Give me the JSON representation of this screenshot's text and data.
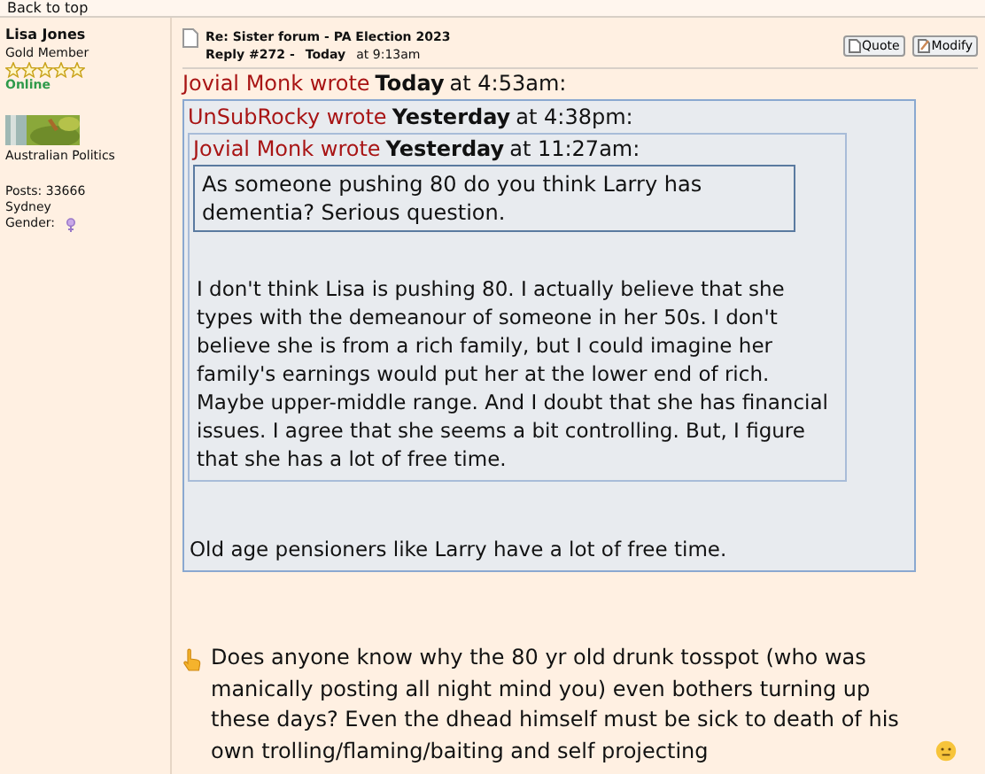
{
  "back_to_top": "Back to top",
  "author": {
    "name": "Lisa Jones",
    "rank": "Gold Member",
    "stars": 5,
    "status": "Online",
    "group": "Australian Politics",
    "posts": "Posts: 33666",
    "location": "Sydney",
    "gender_label": "Gender:"
  },
  "post": {
    "title": "Re: Sister forum - PA Election 2023",
    "reply": "Reply #272 -",
    "day": "Today",
    "time": "at 9:13am",
    "buttons": [
      "Quote",
      "Modify"
    ]
  },
  "quote": {
    "author": "Jovial Monk wrote",
    "day": "Today",
    "time": "at 4:53am:",
    "inner": {
      "author": "UnSubRocky wrote",
      "day": "Yesterday",
      "time": "at 4:38pm:",
      "inner": {
        "author": "Jovial Monk wrote",
        "day": "Yesterday",
        "time": "at 11:27am:",
        "text": "As someone pushing 80 do you think Larry has dementia? Serious question."
      },
      "text": "I don't think Lisa is pushing 80. I actually believe that she types with the demeanour of someone in her 50s. I don't believe she is from a rich family, but I could imagine her family's earnings would put her at the lower end of rich. Maybe upper-middle range. And I doubt that she has financial issues. I agree that she seems a bit controlling. But, I figure that she has a lot of free time."
    },
    "text": "Old age pensioners like Larry have a lot of free time."
  },
  "body": "Does anyone know why the 80 yr old drunk tosspot (who was manically posting all night mind you) even bothers turning up these days? Even the dhead himself must be sick to death of his own trolling/flaming/baiting and self projecting"
}
